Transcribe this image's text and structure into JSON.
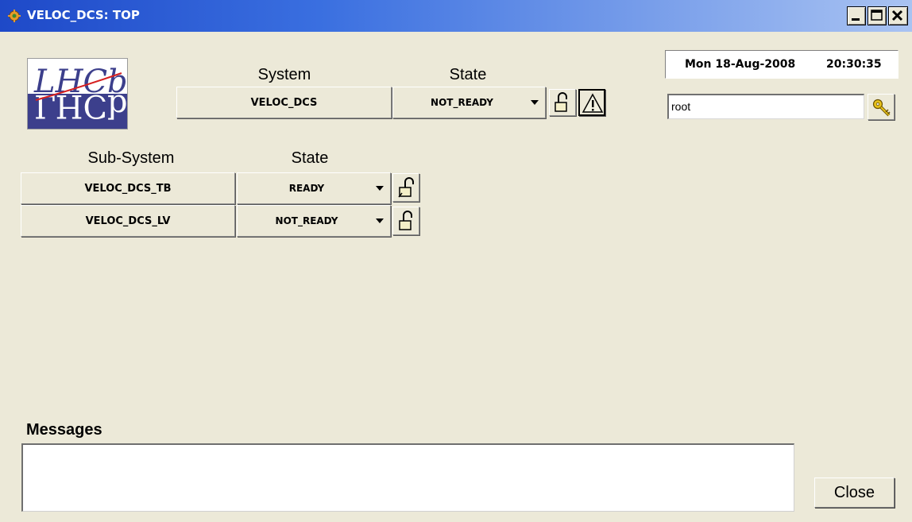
{
  "window": {
    "title": "VELOC_DCS: TOP",
    "controls": {
      "minimize_icon": "minimize-icon",
      "maximize_icon": "maximize-icon",
      "close_icon": "close-icon"
    }
  },
  "logo": {
    "text": "LHCb"
  },
  "system": {
    "header_system": "System",
    "header_state": "State",
    "name": "VELOC_DCS",
    "state": "NOT_READY"
  },
  "subsystems": {
    "header_subsystem": "Sub-System",
    "header_state": "State",
    "rows": [
      {
        "name": "VELOC_DCS_TB",
        "state": "READY"
      },
      {
        "name": "VELOC_DCS_LV",
        "state": "NOT_READY"
      }
    ]
  },
  "datetime": {
    "date": "Mon 18-Aug-2008",
    "time": "20:30:35"
  },
  "user": {
    "name": "root"
  },
  "messages": {
    "label": "Messages",
    "content": ""
  },
  "close_label": "Close",
  "colors": {
    "titlebar_start": "#1e49c8",
    "titlebar_end": "#a9c3f2",
    "window_bg": "#ece9d8",
    "logo_bg": "#3c3f8c",
    "key_yellow": "#e8c21a"
  }
}
